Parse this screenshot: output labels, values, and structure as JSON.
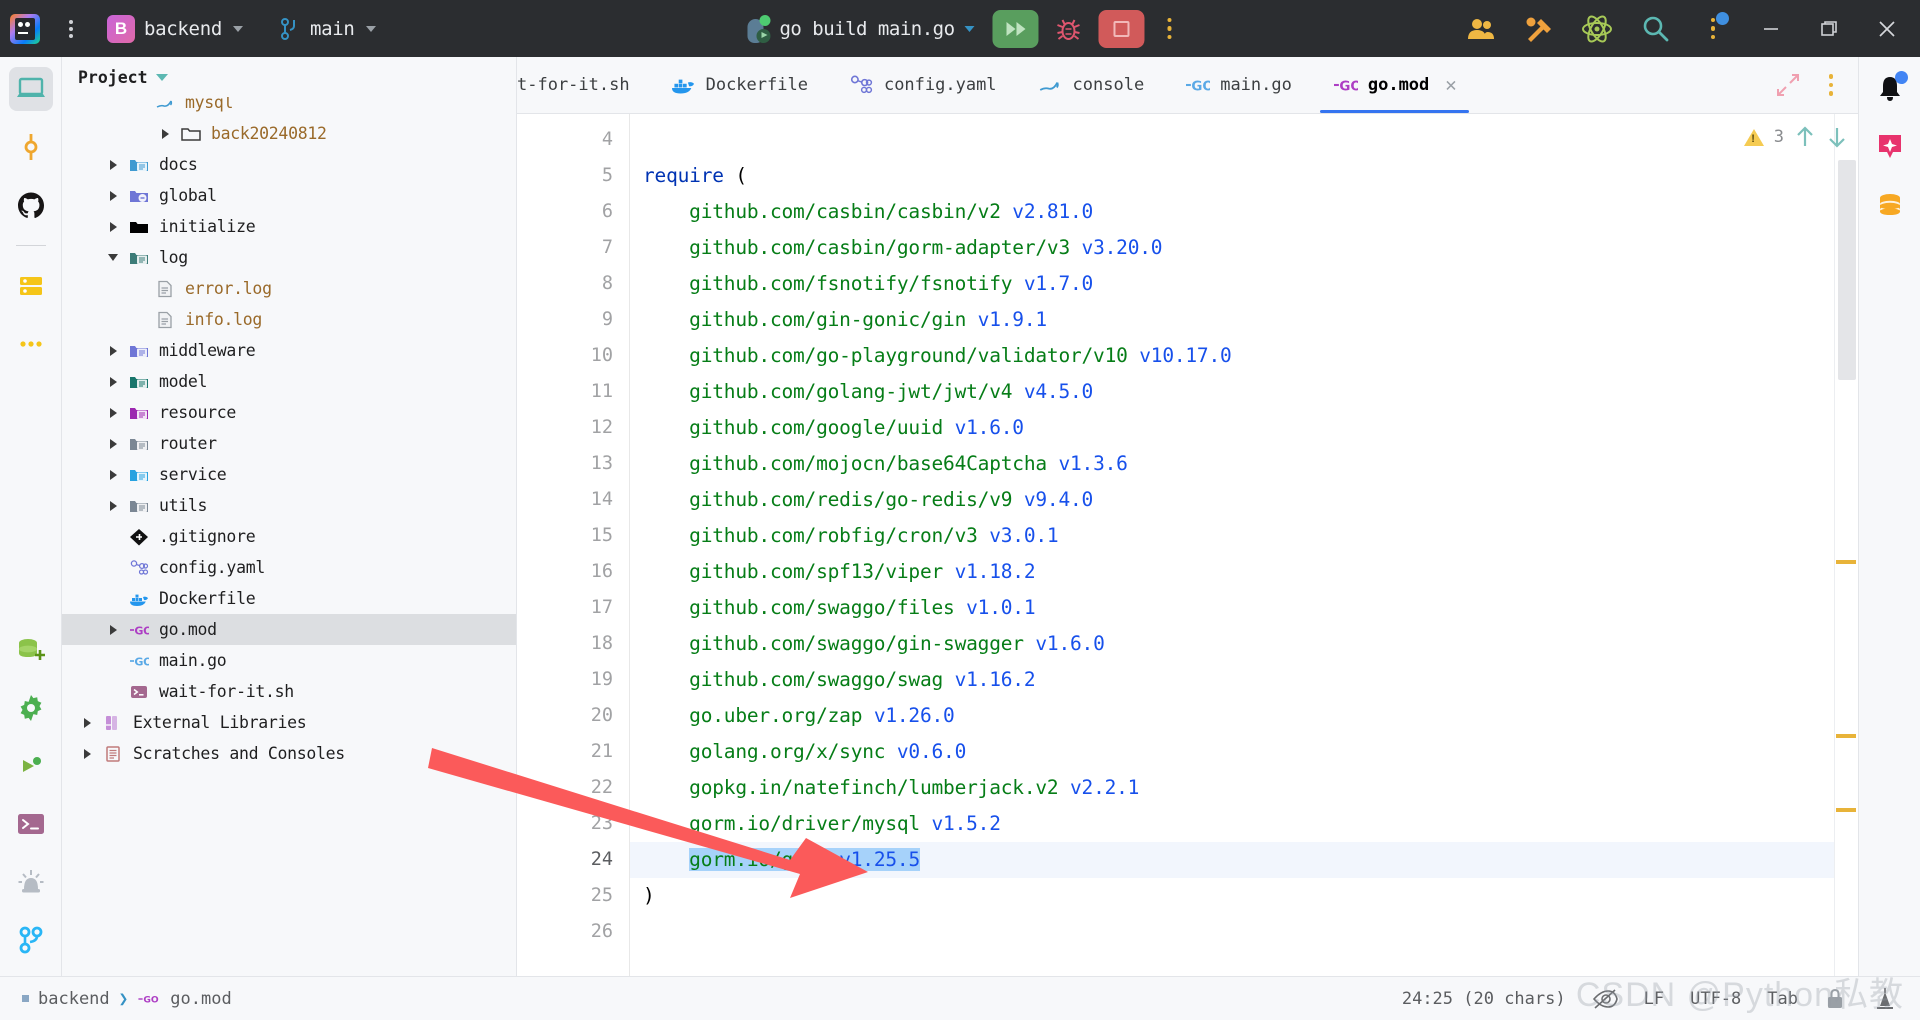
{
  "titlebar": {
    "project_badge": "B",
    "project_name": "backend",
    "branch_name": "main",
    "run_config": "go build main.go",
    "icons": {
      "app_logo": "intellij-logo-icon",
      "main_menu": "hamburger-kebab-icon",
      "run": "run-play-icon",
      "debug": "debug-bug-icon",
      "stop": "stop-square-icon",
      "more": "more-vertical-icon",
      "collab": "collaborate-people-icon",
      "tools": "tools-hammer-wrench-icon",
      "plugin": "atom-plugin-icon",
      "search": "search-magnifier-icon",
      "updates": "updates-kebab-icon",
      "minimize": "window-minimize-icon",
      "maximize": "window-maximize-icon",
      "close": "window-close-icon"
    }
  },
  "left_rail": [
    {
      "name": "project-tool-window",
      "icon": "laptop-project-icon",
      "active": true
    },
    {
      "name": "commit-tool-window",
      "icon": "commit-node-icon",
      "active": false
    },
    {
      "name": "github-tool-window",
      "icon": "github-octocat-icon",
      "active": false
    },
    {
      "name": "database-tool-window",
      "icon": "database-server-icon",
      "active": false
    },
    {
      "name": "more-tool-windows",
      "icon": "more-horizontal-icon",
      "active": false
    }
  ],
  "left_rail_bottom": [
    {
      "name": "database-add",
      "icon": "database-plus-icon"
    },
    {
      "name": "settings",
      "icon": "gear-icon"
    },
    {
      "name": "run-tool-window",
      "icon": "run-green-triangle-icon"
    },
    {
      "name": "terminal-tool-window",
      "icon": "terminal-prompt-icon"
    },
    {
      "name": "problems-tool-window",
      "icon": "siren-alert-icon"
    },
    {
      "name": "version-control",
      "icon": "git-branch-icon"
    }
  ],
  "right_rail": [
    {
      "name": "notifications",
      "icon": "bell-icon",
      "badge": true
    },
    {
      "name": "ai-assistant",
      "icon": "ai-sparkle-icon",
      "badge": false
    },
    {
      "name": "database",
      "icon": "database-cylinder-icon",
      "badge": false
    }
  ],
  "project_panel": {
    "title": "Project",
    "tree": [
      {
        "label": "mysql",
        "indent": 2,
        "twisty": "none",
        "icon_color": "#3f9ad1",
        "icon_kind": "mysql",
        "label_color": "brown",
        "clipped": true
      },
      {
        "label": "back20240812",
        "indent": 3,
        "twisty": "closed",
        "icon_color": "#ffffff",
        "icon_kind": "folder-outline",
        "label_color": "brown"
      },
      {
        "label": "docs",
        "indent": 1,
        "twisty": "closed",
        "icon_color": "#3f9ad1",
        "icon_kind": "folder-doc",
        "label_color": "dark"
      },
      {
        "label": "global",
        "indent": 1,
        "twisty": "closed",
        "icon_color": "#6f76d6",
        "icon_kind": "folder-go",
        "label_color": "dark"
      },
      {
        "label": "initialize",
        "indent": 1,
        "twisty": "closed",
        "icon_color": "#000000",
        "icon_kind": "folder-plain",
        "label_color": "dark"
      },
      {
        "label": "log",
        "indent": 1,
        "twisty": "open",
        "icon_color": "#3d7c78",
        "icon_kind": "folder-doc",
        "label_color": "dark"
      },
      {
        "label": "error.log",
        "indent": 2,
        "twisty": "none",
        "icon_color": "#9aa0a6",
        "icon_kind": "file-text",
        "label_color": "brown"
      },
      {
        "label": "info.log",
        "indent": 2,
        "twisty": "none",
        "icon_color": "#9aa0a6",
        "icon_kind": "file-text",
        "label_color": "brown"
      },
      {
        "label": "middleware",
        "indent": 1,
        "twisty": "closed",
        "icon_color": "#6f76d6",
        "icon_kind": "folder-doc",
        "label_color": "dark"
      },
      {
        "label": "model",
        "indent": 1,
        "twisty": "closed",
        "icon_color": "#18756b",
        "icon_kind": "folder-doc",
        "label_color": "dark"
      },
      {
        "label": "resource",
        "indent": 1,
        "twisty": "closed",
        "icon_color": "#9c27b0",
        "icon_kind": "folder-doc",
        "label_color": "dark"
      },
      {
        "label": "router",
        "indent": 1,
        "twisty": "closed",
        "icon_color": "#7b8794",
        "icon_kind": "folder-doc",
        "label_color": "dark"
      },
      {
        "label": "service",
        "indent": 1,
        "twisty": "closed",
        "icon_color": "#27a2e0",
        "icon_kind": "folder-doc",
        "label_color": "dark"
      },
      {
        "label": "utils",
        "indent": 1,
        "twisty": "closed",
        "icon_color": "#7b8794",
        "icon_kind": "folder-doc",
        "label_color": "dark"
      },
      {
        "label": ".gitignore",
        "indent": 1,
        "twisty": "none",
        "icon_color": "#111111",
        "icon_kind": "git",
        "label_color": "dark"
      },
      {
        "label": "config.yaml",
        "indent": 1,
        "twisty": "none",
        "icon_color": "#6f76d6",
        "icon_kind": "yaml",
        "label_color": "dark"
      },
      {
        "label": "Dockerfile",
        "indent": 1,
        "twisty": "none",
        "icon_color": "#2496ed",
        "icon_kind": "docker",
        "label_color": "dark"
      },
      {
        "label": "go.mod",
        "indent": 1,
        "twisty": "closed",
        "icon_color": "#ad3ec4",
        "icon_kind": "go",
        "label_color": "dark",
        "selected": true
      },
      {
        "label": "main.go",
        "indent": 1,
        "twisty": "none",
        "icon_color": "#5aa9e6",
        "icon_kind": "go",
        "label_color": "dark"
      },
      {
        "label": "wait-for-it.sh",
        "indent": 1,
        "twisty": "none",
        "icon_color": "#a4688f",
        "icon_kind": "shell",
        "label_color": "dark"
      },
      {
        "label": "External Libraries",
        "indent": 0,
        "twisty": "closed",
        "icon_color": "#c58fd8",
        "icon_kind": "library",
        "label_color": "dark"
      },
      {
        "label": "Scratches and Consoles",
        "indent": 0,
        "twisty": "closed",
        "icon_color": "#c07a7a",
        "icon_kind": "scratch",
        "label_color": "dark"
      }
    ]
  },
  "editor": {
    "tabs": [
      {
        "label": "t-for-it.sh",
        "icon": "shell-icon",
        "active": false,
        "clipped": true,
        "closable": false
      },
      {
        "label": "Dockerfile",
        "icon": "docker-icon",
        "active": false,
        "clipped": false,
        "closable": false
      },
      {
        "label": "config.yaml",
        "icon": "yaml-icon",
        "active": false,
        "clipped": false,
        "closable": false
      },
      {
        "label": "console",
        "icon": "mysql-icon",
        "active": false,
        "clipped": false,
        "closable": false
      },
      {
        "label": "main.go",
        "icon": "go-icon",
        "active": false,
        "clipped": false,
        "closable": false
      },
      {
        "label": "go.mod",
        "icon": "gomod-icon",
        "active": true,
        "clipped": false,
        "closable": true
      }
    ],
    "tabbar_actions": [
      {
        "name": "expand-editor-button",
        "icon": "expand-diagonal-icon"
      },
      {
        "name": "tab-options-button",
        "icon": "more-vertical-icon"
      }
    ],
    "inspection": {
      "warning_count": "3",
      "prev_icon": "arrow-up-icon",
      "next_icon": "arrow-down-icon"
    },
    "first_line_number": 4,
    "lines": [
      {
        "num": 4,
        "tokens": []
      },
      {
        "num": 5,
        "tokens": [
          {
            "t": "require ",
            "c": "kw"
          },
          {
            "t": "(",
            "c": "punc"
          }
        ]
      },
      {
        "num": 6,
        "tokens": [
          {
            "t": "    github.com/casbin/casbin/v2 ",
            "c": "mod"
          },
          {
            "t": "v2.81.0",
            "c": "ver"
          }
        ]
      },
      {
        "num": 7,
        "tokens": [
          {
            "t": "    github.com/casbin/gorm-adapter/v3 ",
            "c": "mod"
          },
          {
            "t": "v3.20.0",
            "c": "ver"
          }
        ]
      },
      {
        "num": 8,
        "tokens": [
          {
            "t": "    github.com/fsnotify/fsnotify ",
            "c": "mod"
          },
          {
            "t": "v1.7.0",
            "c": "ver"
          }
        ]
      },
      {
        "num": 9,
        "tokens": [
          {
            "t": "    github.com/gin-gonic/gin ",
            "c": "mod"
          },
          {
            "t": "v1.9.1",
            "c": "ver"
          }
        ]
      },
      {
        "num": 10,
        "tokens": [
          {
            "t": "    github.com/go-playground/validator/v10 ",
            "c": "mod"
          },
          {
            "t": "v10.17.0",
            "c": "ver"
          }
        ]
      },
      {
        "num": 11,
        "tokens": [
          {
            "t": "    github.com/golang-jwt/jwt/v4 ",
            "c": "mod"
          },
          {
            "t": "v4.5.0",
            "c": "ver"
          }
        ]
      },
      {
        "num": 12,
        "tokens": [
          {
            "t": "    github.com/google/uuid ",
            "c": "mod"
          },
          {
            "t": "v1.6.0",
            "c": "ver"
          }
        ]
      },
      {
        "num": 13,
        "tokens": [
          {
            "t": "    github.com/mojocn/base64Captcha ",
            "c": "mod"
          },
          {
            "t": "v1.3.6",
            "c": "ver"
          }
        ]
      },
      {
        "num": 14,
        "tokens": [
          {
            "t": "    github.com/redis/go-redis/v9 ",
            "c": "mod"
          },
          {
            "t": "v9.4.0",
            "c": "ver"
          }
        ]
      },
      {
        "num": 15,
        "tokens": [
          {
            "t": "    github.com/robfig/cron/v3 ",
            "c": "mod"
          },
          {
            "t": "v3.0.1",
            "c": "ver"
          }
        ]
      },
      {
        "num": 16,
        "tokens": [
          {
            "t": "    github.com/spf13/viper ",
            "c": "mod"
          },
          {
            "t": "v1.18.2",
            "c": "ver"
          }
        ]
      },
      {
        "num": 17,
        "tokens": [
          {
            "t": "    github.com/swaggo/files ",
            "c": "mod"
          },
          {
            "t": "v1.0.1",
            "c": "ver"
          }
        ]
      },
      {
        "num": 18,
        "tokens": [
          {
            "t": "    github.com/swaggo/gin-swagger ",
            "c": "mod"
          },
          {
            "t": "v1.6.0",
            "c": "ver"
          }
        ]
      },
      {
        "num": 19,
        "tokens": [
          {
            "t": "    github.com/swaggo/swag ",
            "c": "mod"
          },
          {
            "t": "v1.16.2",
            "c": "ver"
          }
        ]
      },
      {
        "num": 20,
        "tokens": [
          {
            "t": "    go.uber.org/zap ",
            "c": "mod"
          },
          {
            "t": "v1.26.0",
            "c": "ver"
          }
        ]
      },
      {
        "num": 21,
        "tokens": [
          {
            "t": "    golang.org/x/sync ",
            "c": "mod"
          },
          {
            "t": "v0.6.0",
            "c": "ver"
          }
        ]
      },
      {
        "num": 22,
        "tokens": [
          {
            "t": "    gopkg.in/natefinch/lumberjack.v2 ",
            "c": "mod"
          },
          {
            "t": "v2.2.1",
            "c": "ver"
          }
        ]
      },
      {
        "num": 23,
        "tokens": [
          {
            "t": "    gorm.io/driver/mysql ",
            "c": "mod"
          },
          {
            "t": "v1.5.2",
            "c": "ver"
          }
        ],
        "bulb": true
      },
      {
        "num": 24,
        "tokens": [
          {
            "t": "    ",
            "c": "mod"
          },
          {
            "t": "gorm.io/gorm ",
            "c": "mod",
            "sel": true
          },
          {
            "t": "v1.25.5",
            "c": "ver",
            "sel": true
          }
        ],
        "highlight": true
      },
      {
        "num": 25,
        "tokens": [
          {
            "t": ")",
            "c": "punc"
          }
        ]
      },
      {
        "num": 26,
        "tokens": []
      }
    ]
  },
  "statusbar": {
    "breadcrumb": [
      "backend",
      "go.mod"
    ],
    "caret_position": "24:25 (20 chars)",
    "line_separator": "LF",
    "encoding": "UTF-8",
    "indent": "Tab",
    "icons": {
      "reader_mode": "reader-mode-eye-icon",
      "lock": "lock-icon",
      "inspections": "inspections-icon"
    }
  },
  "watermark": "CSDN @Python私教",
  "colors": {
    "accent_blue": "#3574f0",
    "keyword": "#0033b3",
    "module": "#067d17",
    "version": "#1750eb",
    "selection": "#a6d2fa",
    "line_highlight": "#f2f6fd",
    "titlebar_bg": "#2b2d30",
    "panel_bg": "#f7f8fa",
    "arrow_red": "#fb5a5a"
  }
}
